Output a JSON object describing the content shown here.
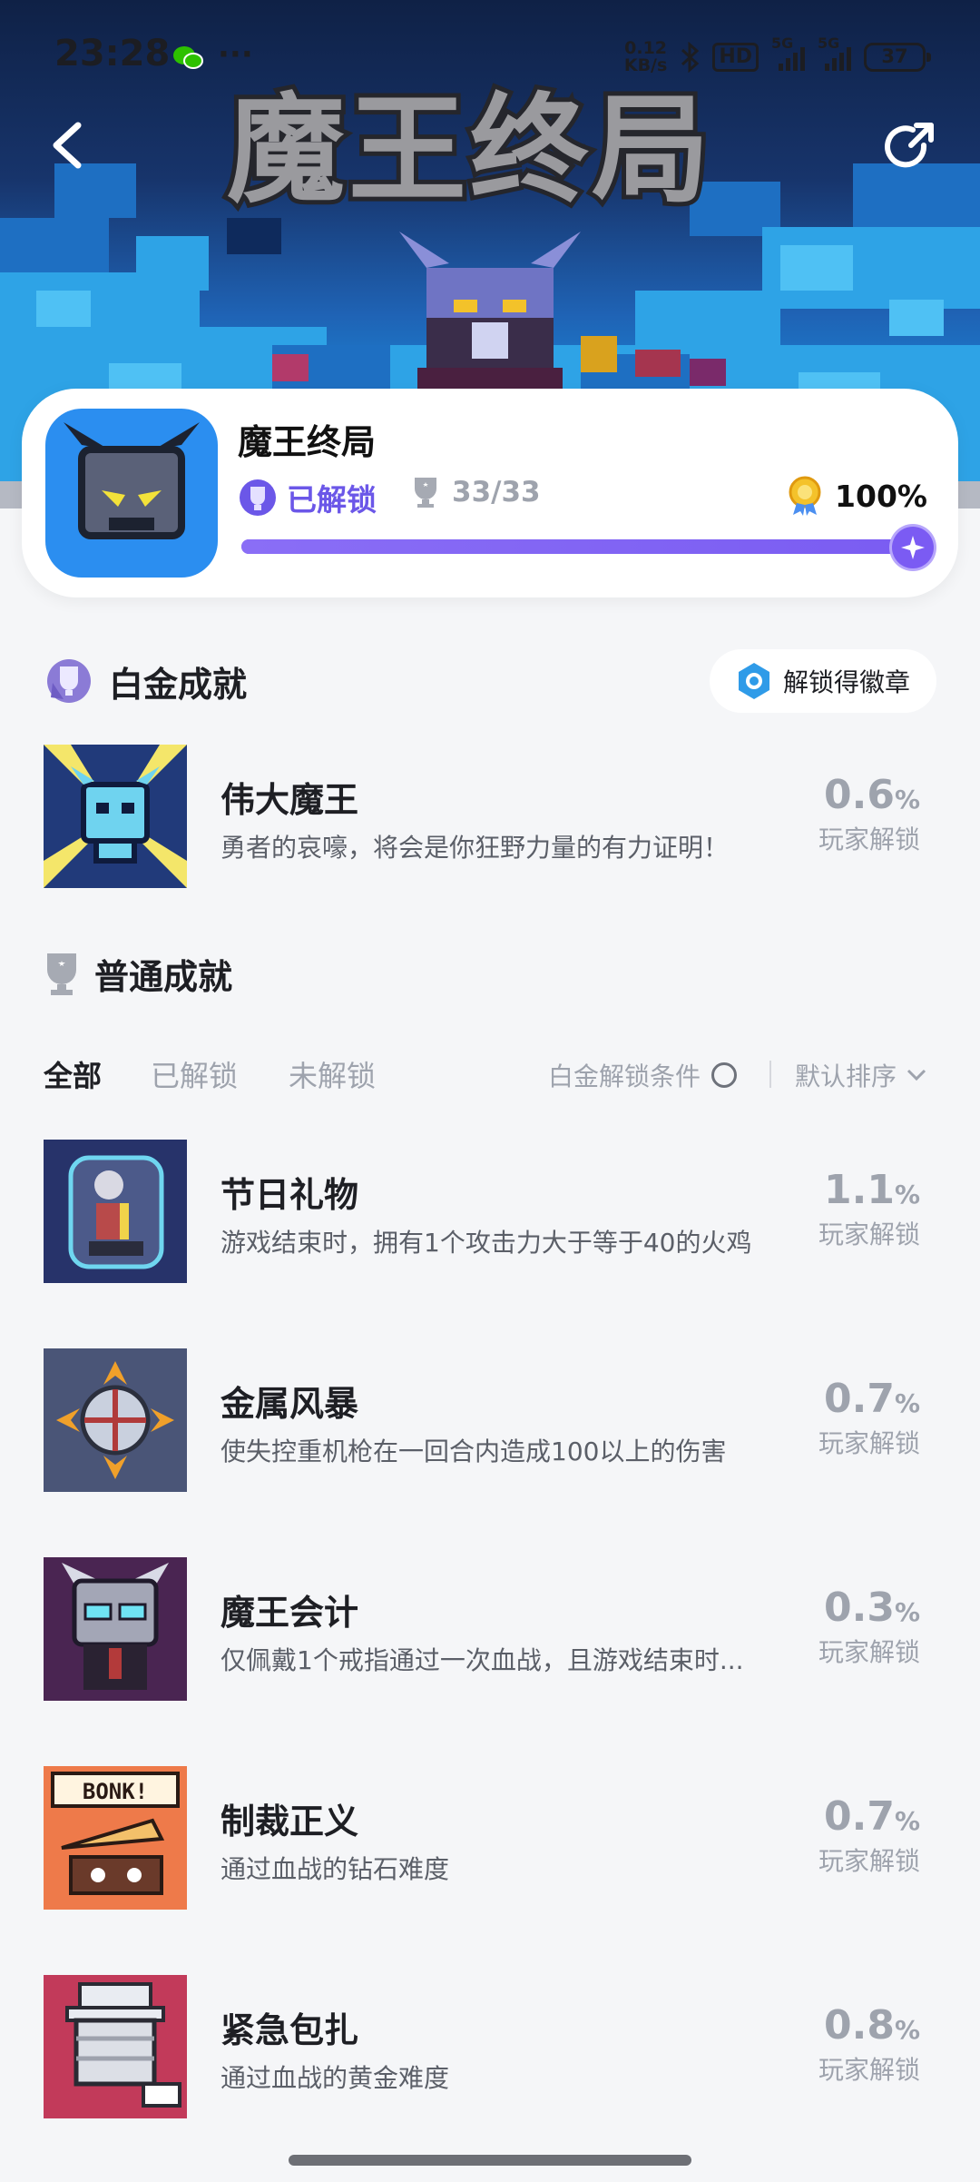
{
  "status_bar": {
    "time": "23:28",
    "more": "···",
    "net_speed_value": "0.12",
    "net_speed_unit": "KB/s",
    "hd_label": "HD",
    "sim1": "5G",
    "sim2": "5G",
    "battery": "37"
  },
  "hero": {
    "title": "魔王终局"
  },
  "game": {
    "name": "魔王终局",
    "unlock_label": "已解锁",
    "trophy_count": "33/33",
    "percent": "100%",
    "progress": 1.0
  },
  "platinum": {
    "heading": "白金成就",
    "badge_button": "解锁得徽章",
    "item": {
      "name": "伟大魔王",
      "desc": "勇者的哀嚎，将会是你狂野力量的有力证明！",
      "rate": "0.6",
      "unit": "%",
      "caption": "玩家解锁"
    }
  },
  "normal": {
    "heading": "普通成就",
    "tabs": [
      "全部",
      "已解锁",
      "未解锁"
    ],
    "condition_label": "白金解锁条件",
    "sort_label": "默认排序",
    "items": [
      {
        "name": "节日礼物",
        "desc": "游戏结束时，拥有1个攻击力大于等于40的火鸡",
        "rate": "1.1",
        "unit": "%",
        "caption": "玩家解锁"
      },
      {
        "name": "金属风暴",
        "desc": "使失控重机枪在一回合内造成100以上的伤害",
        "rate": "0.7",
        "unit": "%",
        "caption": "玩家解锁"
      },
      {
        "name": "魔王会计",
        "desc": "仅佩戴1个戒指通过一次血战，且游戏结束时...",
        "rate": "0.3",
        "unit": "%",
        "caption": "玩家解锁"
      },
      {
        "name": "制裁正义",
        "desc": "通过血战的钻石难度",
        "rate": "0.7",
        "unit": "%",
        "caption": "玩家解锁"
      },
      {
        "name": "紧急包扎",
        "desc": "通过血战的黄金难度",
        "rate": "0.8",
        "unit": "%",
        "caption": "玩家解锁"
      }
    ],
    "item_art_text": "BONK!"
  },
  "colors": {
    "accent": "#6b57e8",
    "muted": "#9ea3ad",
    "background": "#f5f6f8"
  },
  "icons": [
    "back-icon",
    "share-icon",
    "wechat-icon",
    "bluetooth-icon",
    "trophy-icon",
    "medal-icon",
    "platinum-trophy-icon",
    "badge-icon",
    "chevron-down-icon"
  ]
}
